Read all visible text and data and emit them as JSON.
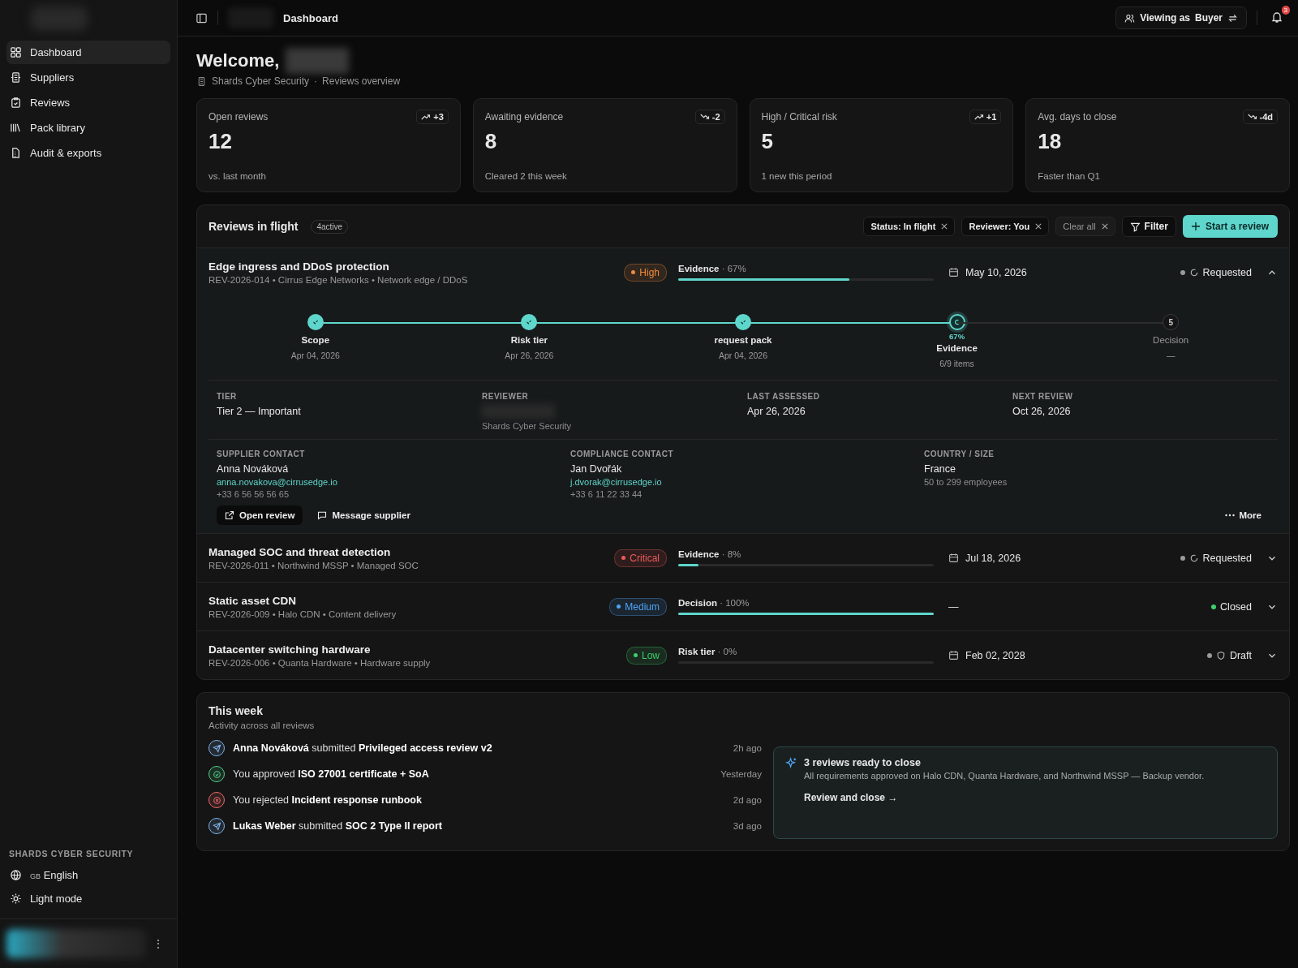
{
  "sidebar": {
    "items": [
      {
        "label": "Dashboard",
        "selected": true
      },
      {
        "label": "Suppliers",
        "selected": false
      },
      {
        "label": "Reviews",
        "selected": false
      },
      {
        "label": "Pack library",
        "selected": false
      },
      {
        "label": "Audit & exports",
        "selected": false
      }
    ],
    "org_heading": "SHARDS CYBER SECURITY",
    "footer_items": [
      {
        "label": "English",
        "prefix": "GB"
      },
      {
        "label": "Light mode"
      }
    ],
    "user_menu": "⋮"
  },
  "header": {
    "title": "Dashboard",
    "viewing_as": "Viewing as",
    "role": "Buyer",
    "notifications": "3"
  },
  "welcome": {
    "title": "Welcome,",
    "org": "Shards Cyber Security",
    "separator": "·",
    "subtitle": "Reviews  overview"
  },
  "stats": [
    {
      "label": "Open reviews",
      "value": "12",
      "note": "vs. last month",
      "delta": "+3",
      "rising": true
    },
    {
      "label": "Awaiting evidence",
      "value": "8",
      "note": "Cleared 2 this week",
      "delta": "-2",
      "rising": false
    },
    {
      "label": "High / Critical risk",
      "value": "5",
      "note": "1 new this period",
      "delta": "+1",
      "rising": true
    },
    {
      "label": "Avg. days to close",
      "value": "18",
      "note": "Faster than Q1",
      "delta": "-4d",
      "rising": false
    }
  ],
  "reviews": {
    "title": "Reviews in flight",
    "count": "4active",
    "filters": [
      {
        "label": "Status: In flight",
        "kind": "chip"
      },
      {
        "label": "Reviewer: You",
        "kind": "chip"
      },
      {
        "label": "Clear all",
        "kind": "clear"
      }
    ],
    "filter_button": "Filter",
    "start_button": "Start a review",
    "rows": [
      {
        "title": "Edge ingress and DDoS protection",
        "meta": "REV-2026-014 • Cirrus Edge Networks • Network edge / DDoS",
        "risk": "High",
        "color": "#f08a3c",
        "stage": "Evidence",
        "percent": "· 67%",
        "level": 0.67,
        "date": "May 10, 2026",
        "status": "Requested",
        "kind": "requested",
        "expanded": true,
        "steps": [
          {
            "label": "Scope",
            "sub": "Apr 04, 2026",
            "kind": "done"
          },
          {
            "label": "Risk tier",
            "sub": "Apr 26, 2026",
            "kind": "done"
          },
          {
            "label": "request pack",
            "sub": "Apr 04, 2026",
            "kind": "done"
          },
          {
            "label": "Evidence",
            "sub": "6/9 items",
            "kind": "current",
            "percent": "67%"
          },
          {
            "label": "Decision",
            "sub": "—",
            "kind": "todo",
            "number": "5"
          }
        ],
        "facts": [
          {
            "label": "TIER",
            "value": "Tier 2 — Important"
          },
          {
            "label": "REVIEWER",
            "note": "Shards Cyber Security"
          },
          {
            "label": "LAST ASSESSED",
            "value": "Apr 26, 2026"
          },
          {
            "label": "NEXT REVIEW",
            "value": "Oct 26, 2026"
          }
        ],
        "contacts": [
          {
            "label": "SUPPLIER CONTACT",
            "name": "Anna Nováková",
            "email": "anna.novakova@cirrusedge.io",
            "phone": "+33 6 56 56 56 65"
          },
          {
            "label": "COMPLIANCE CONTACT",
            "name": "Jan Dvořák",
            "email": "j.dvorak@cirrusedge.io",
            "phone": "+33 6 11 22 33 44"
          },
          {
            "label": "COUNTRY / SIZE",
            "name": "France",
            "phone": "50 to 299 employees"
          }
        ],
        "actions": {
          "open": "Open  review",
          "message": "Message supplier",
          "more": "More"
        }
      },
      {
        "title": "Managed SOC and threat detection",
        "meta": "REV-2026-011 • Northwind MSSP • Managed SOC",
        "risk": "Critical",
        "color": "#ef5a5a",
        "stage": "Evidence",
        "percent": "· 8%",
        "level": 0.08,
        "date": "Jul 18, 2026",
        "status": "Requested",
        "kind": "requested",
        "expanded": false
      },
      {
        "title": "Static asset CDN",
        "meta": "REV-2026-009 • Halo CDN • Content delivery",
        "risk": "Medium",
        "color": "#4ea3f5",
        "stage": "Decision",
        "percent": "· 100%",
        "level": 1,
        "date": "—",
        "status": "Closed",
        "kind": "closed",
        "expanded": false
      },
      {
        "title": "Datacenter switching hardware",
        "meta": "REV-2026-006 • Quanta Hardware • Hardware supply",
        "risk": "Low",
        "color": "#3fcf6e",
        "stage": "Risk tier",
        "percent": "· 0%",
        "level": 0,
        "date": "Feb 02, 2028",
        "status": "Draft",
        "kind": "draft",
        "expanded": false
      }
    ]
  },
  "this_week": {
    "title": "This week",
    "subtitle": "Activity across all reviews",
    "activity": [
      {
        "text": "**Anna Nováková** submitted **Privileged access review v2**",
        "time": "2h ago",
        "kind": "submitted"
      },
      {
        "text": "You approved **ISO 27001 certificate + SoA**",
        "time": "Yesterday",
        "kind": "approved"
      },
      {
        "text": "You rejected **Incident response runbook**",
        "time": "2d ago",
        "kind": "rejected"
      },
      {
        "text": "**Lukas Weber** submitted **SOC 2 Type II report**",
        "time": "3d ago",
        "kind": "submitted"
      }
    ],
    "callout": {
      "title": "3 reviews ready to close",
      "text": "All requirements approved on Halo CDN, Quanta Hardware, and Northwind MSSP — Backup vendor.",
      "link": "Review and close →"
    }
  }
}
